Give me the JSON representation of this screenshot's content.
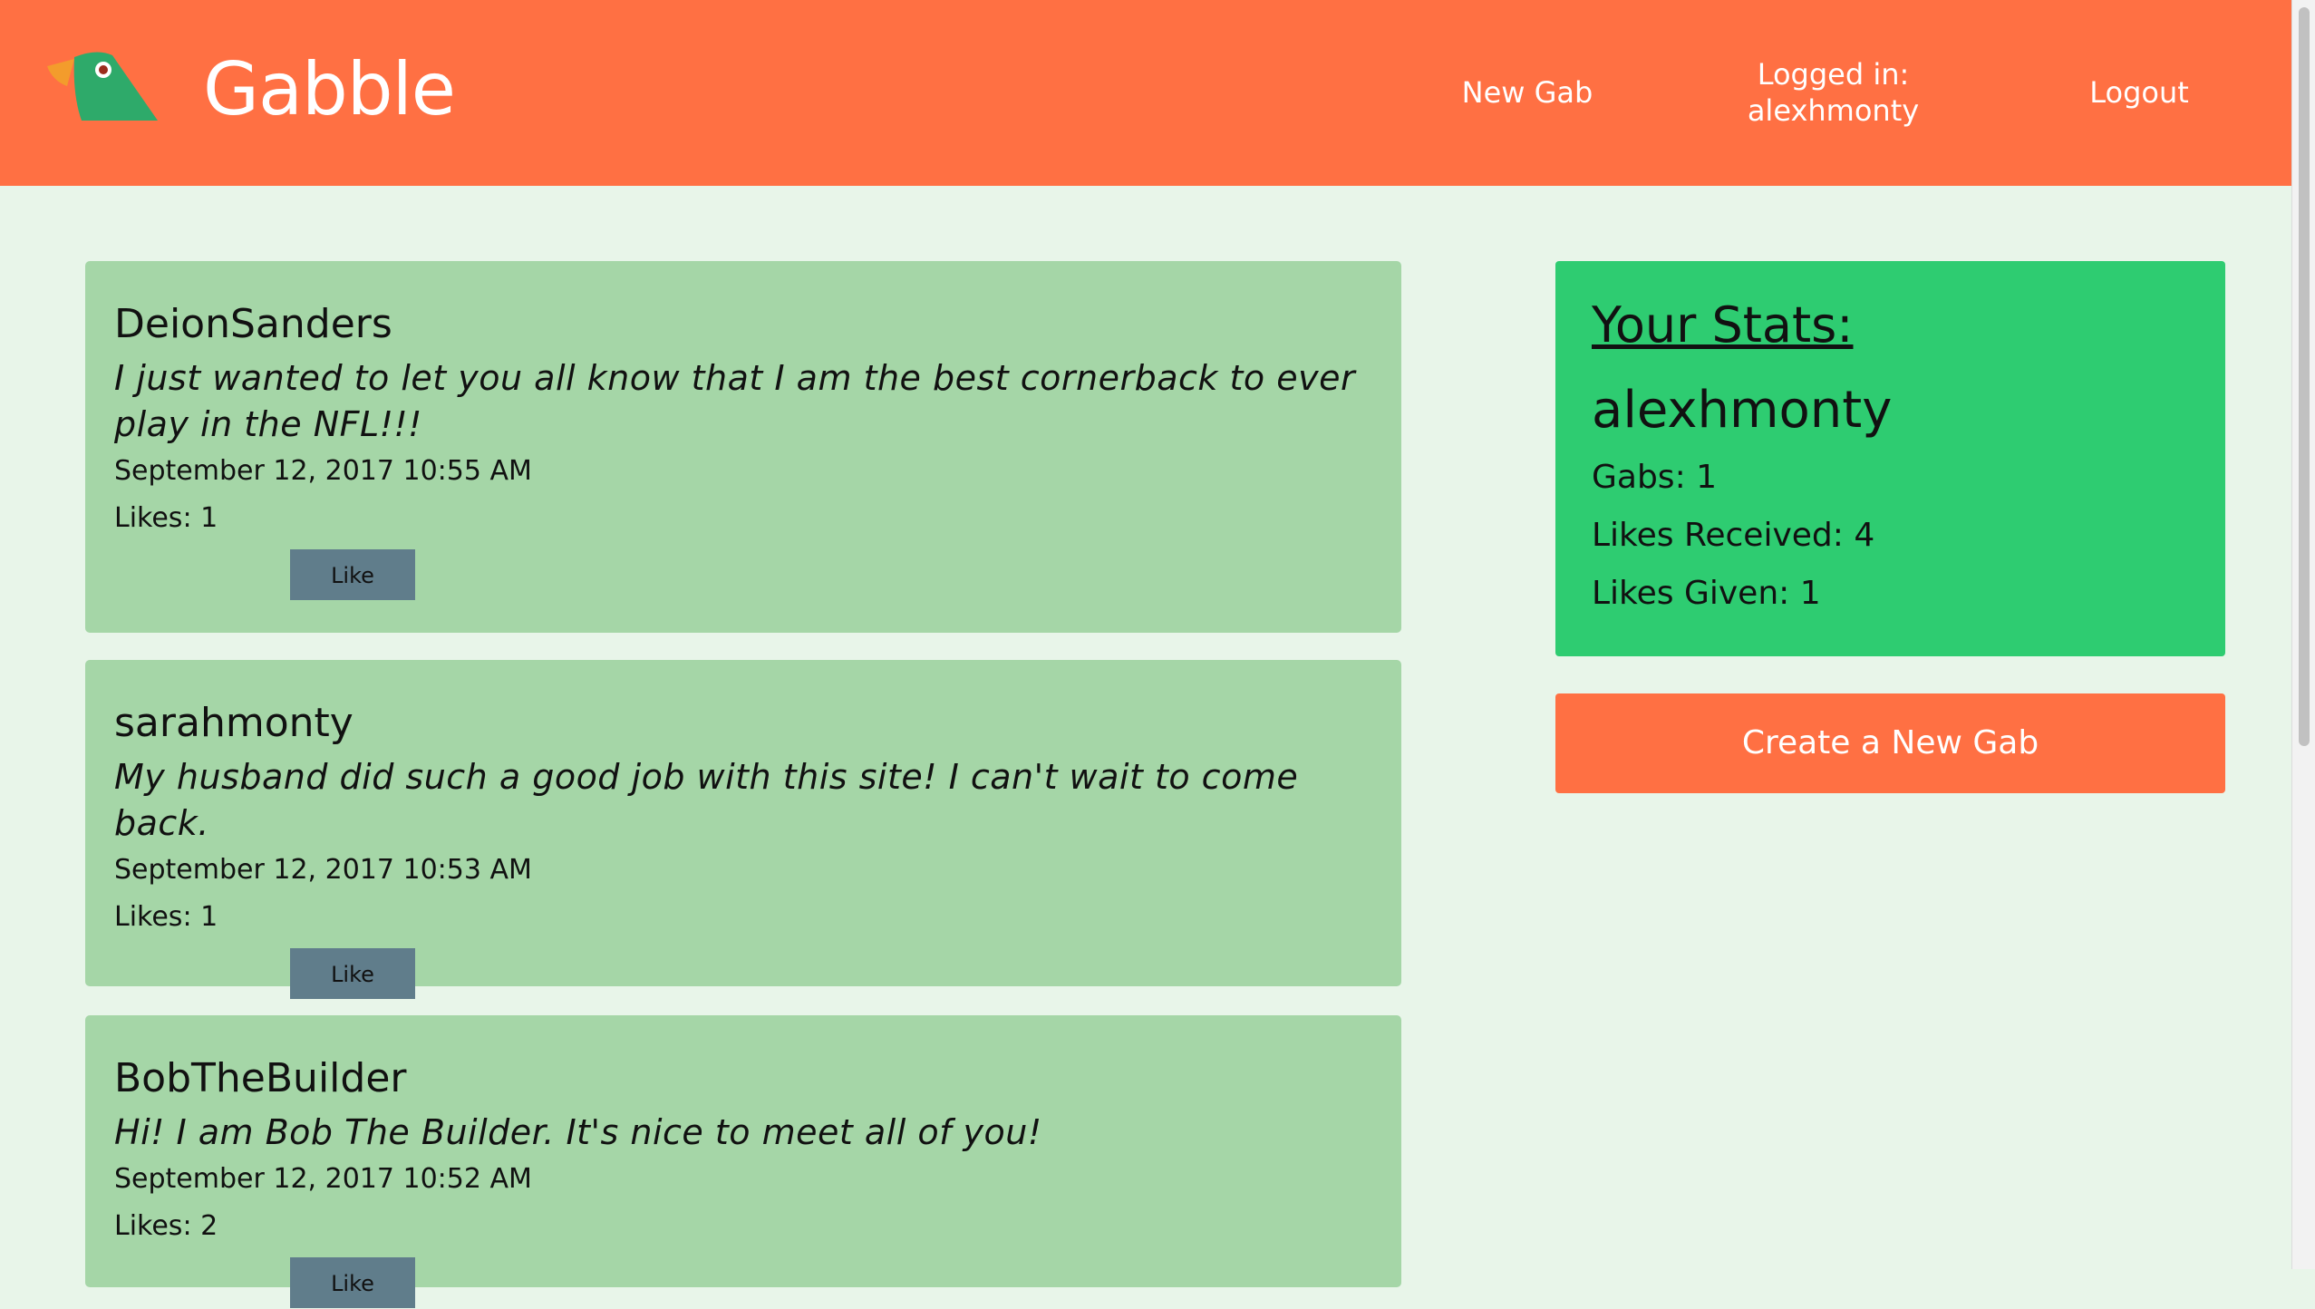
{
  "header": {
    "brand": "Gabble",
    "nav": {
      "new_gab": "New Gab",
      "logged_in_label": "Logged in:",
      "username": "alexhmonty",
      "logout": "Logout"
    },
    "colors": {
      "header_bg": "#ff7043",
      "text": "#ffffff"
    }
  },
  "feed": {
    "gabs": [
      {
        "author": "DeionSanders",
        "text": "I just wanted to let you all know that I am the best cornerback to ever play in the NFL!!!",
        "date": "September 12, 2017 10:55 AM",
        "likes": "Likes: 1",
        "like_label": "Like"
      },
      {
        "author": "sarahmonty",
        "text": "My husband did such a good job with this site! I can't wait to come back.",
        "date": "September 12, 2017 10:53 AM",
        "likes": "Likes: 1",
        "like_label": "Like"
      },
      {
        "author": "BobTheBuilder",
        "text": "Hi! I am Bob The Builder. It's nice to meet all of you!",
        "date": "September 12, 2017 10:52 AM",
        "likes": "Likes: 2",
        "like_label": "Like"
      }
    ]
  },
  "sidebar": {
    "stats_title": "Your Stats:",
    "username": "alexhmonty",
    "gabs": "Gabs: 1",
    "likes_received": "Likes Received: 4",
    "likes_given": "Likes Given: 1",
    "create_label": "Create a New Gab"
  },
  "icons": {
    "logo": "parrot-logo-icon"
  },
  "colors": {
    "page_bg": "#e8f5e9",
    "gab_bg": "#a5d6a7",
    "like_button": "#607d8b",
    "stats_bg": "#2ecc71",
    "create_button": "#ff7043"
  }
}
